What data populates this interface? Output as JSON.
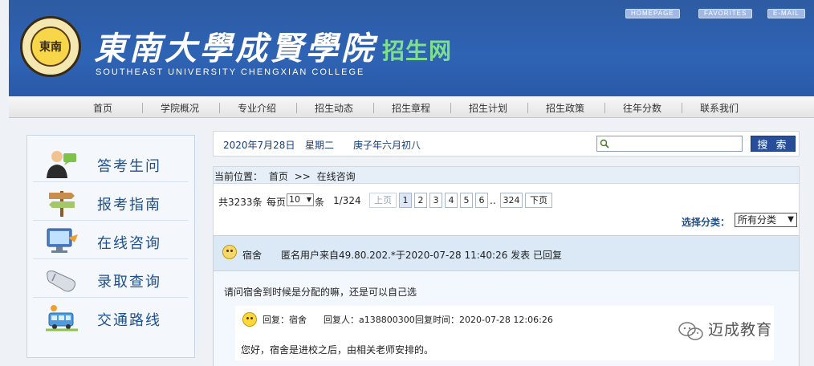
{
  "header": {
    "cn_title": "東南大學成賢學院",
    "en_title": "SOUTHEAST UNIVERSITY CHENGXIAN COLLEGE",
    "site_name": "招生网",
    "logo_text": "東南",
    "links": [
      "HOMEPAGE",
      "FAVORITES",
      "E-MAIL"
    ]
  },
  "nav": [
    "首页",
    "学院概况",
    "专业介绍",
    "招生动态",
    "招生章程",
    "招生计划",
    "招生政策",
    "往年分数",
    "联系我们"
  ],
  "sidebar": [
    "答考生问",
    "报考指南",
    "在线咨询",
    "录取查询",
    "交通路线"
  ],
  "datebar": {
    "date": "2020年7月28日",
    "weekday": "星期二",
    "lunar": "庚子年六月初八",
    "search_placeholder": "",
    "search_label": "搜 索"
  },
  "breadcrumb": {
    "prefix": "当前位置：",
    "home": "首页",
    "sep": ">>",
    "current": "在线咨询"
  },
  "pager": {
    "total": "共3233条",
    "per_page_label": "每页",
    "per_page_value": "10",
    "unit": "条",
    "page_info": "1/324",
    "prev": "上页",
    "pages": [
      "1",
      "2",
      "3",
      "4",
      "5",
      "6"
    ],
    "ellipsis": "..",
    "last": "324",
    "next": "下页"
  },
  "filter": {
    "label": "选择分类：",
    "value": "所有分类"
  },
  "message": {
    "category": "宿舍",
    "meta": "匿名用户来自49.80.202.*于2020-07-28 11:40:26 发表  已回复",
    "question": "请问宿舍到时候是分配的嘛，还是可以自己选",
    "reply_title": "回复：宿舍",
    "replier": "回复人：a138800300",
    "reply_time": "回复时间：2020-07-28 12:06:26",
    "reply_content": "您好，宿舍是进校之后，由相关老师安排的。"
  },
  "watermark": "迈成教育",
  "colors": {
    "header_blue": "#2f64b5",
    "accent_green": "#7de08a",
    "link_blue": "#1e4f8f",
    "button_blue": "#284e9a"
  }
}
